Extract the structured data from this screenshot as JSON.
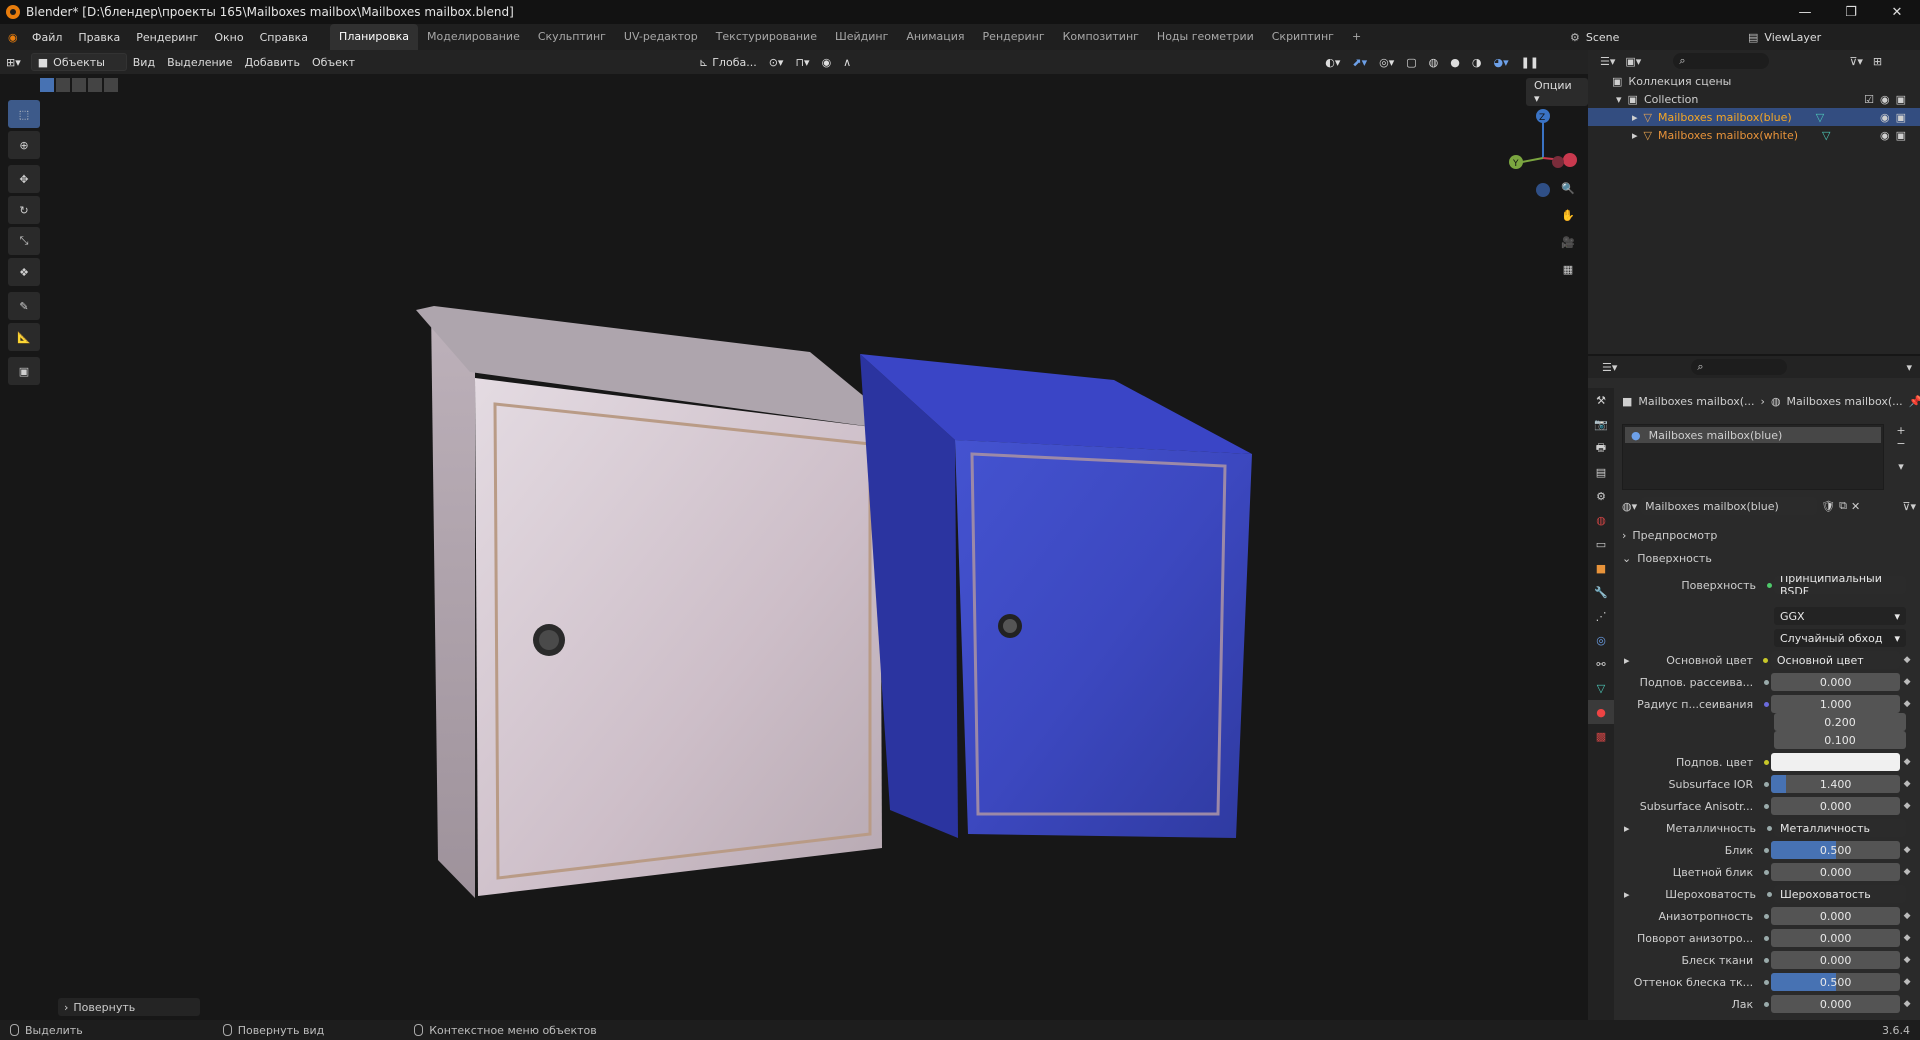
{
  "title": "Blender* [D:\\блендер\\проекты 165\\Mailboxes mailbox\\Mailboxes mailbox.blend]",
  "menu": [
    "Файл",
    "Правка",
    "Рендеринг",
    "Окно",
    "Справка"
  ],
  "workspaces": [
    "Планировка",
    "Моделирование",
    "Скульптинг",
    "UV-редактор",
    "Текстурирование",
    "Шейдинг",
    "Анимация",
    "Рендеринг",
    "Композитинг",
    "Ноды геометрии",
    "Скриптинг"
  ],
  "scene": "Scene",
  "view_layer": "ViewLayer",
  "header3d": {
    "mode": "Объекты",
    "view": "Вид",
    "select": "Выделение",
    "add": "Добавить",
    "object": "Объект",
    "orientation": "Глоба...",
    "options": "Опции"
  },
  "outliner": {
    "root": "Коллекция сцены",
    "collection": "Collection",
    "items": [
      "Mailboxes mailbox(blue)",
      "Mailboxes mailbox(white)"
    ]
  },
  "properties": {
    "breadcrumb_object": "Mailboxes mailbox(...",
    "breadcrumb_material": "Mailboxes mailbox(...",
    "slot": "Mailboxes mailbox(blue)",
    "material_name": "Mailboxes mailbox(blue)",
    "panel_preview": "Предпросмотр",
    "panel_surface": "Поверхность",
    "rows": [
      {
        "label": "Поверхность",
        "value": "Принципиальный BSDF",
        "kind": "link"
      },
      {
        "label": "",
        "value": "GGX",
        "kind": "dropdown"
      },
      {
        "label": "",
        "value": "Случайный обход",
        "kind": "dropdown"
      },
      {
        "label": "Основной цвет",
        "value": "Основной цвет",
        "kind": "link"
      },
      {
        "label": "Подпов. рассеива...",
        "value": "0.000",
        "kind": "num"
      },
      {
        "label": "Радиус п...сеивания",
        "value": "1.000",
        "kind": "num"
      },
      {
        "label": "",
        "value": "0.200",
        "kind": "num"
      },
      {
        "label": "",
        "value": "0.100",
        "kind": "num"
      },
      {
        "label": "Подпов. цвет",
        "value": "",
        "kind": "color"
      },
      {
        "label": "Subsurface IOR",
        "value": "1.400",
        "kind": "num"
      },
      {
        "label": "Subsurface Anisotr...",
        "value": "0.000",
        "kind": "num"
      },
      {
        "label": "Металличность",
        "value": "Металличность",
        "kind": "link"
      },
      {
        "label": "Блик",
        "value": "0.500",
        "kind": "num"
      },
      {
        "label": "Цветной блик",
        "value": "0.000",
        "kind": "num"
      },
      {
        "label": "Шероховатость",
        "value": "Шероховатость",
        "kind": "link"
      },
      {
        "label": "Анизотропность",
        "value": "0.000",
        "kind": "num"
      },
      {
        "label": "Поворот анизотро...",
        "value": "0.000",
        "kind": "num"
      },
      {
        "label": "Блеск ткани",
        "value": "0.000",
        "kind": "num"
      },
      {
        "label": "Оттенок блеска тк...",
        "value": "0.500",
        "kind": "num"
      },
      {
        "label": "Лак",
        "value": "0.000",
        "kind": "num"
      }
    ]
  },
  "last_op": "Повернуть",
  "status": {
    "select": "Выделить",
    "rotate": "Повернуть вид",
    "context": "Контекстное меню объектов",
    "version": "3.6.4"
  },
  "gizmo": {
    "z": "Z",
    "y": "Y"
  },
  "colors": {
    "accent": "#4772b3",
    "selected_text": "#f5a623",
    "blue_box": "#3e4fc4",
    "white_box": "#cfc8cf"
  }
}
